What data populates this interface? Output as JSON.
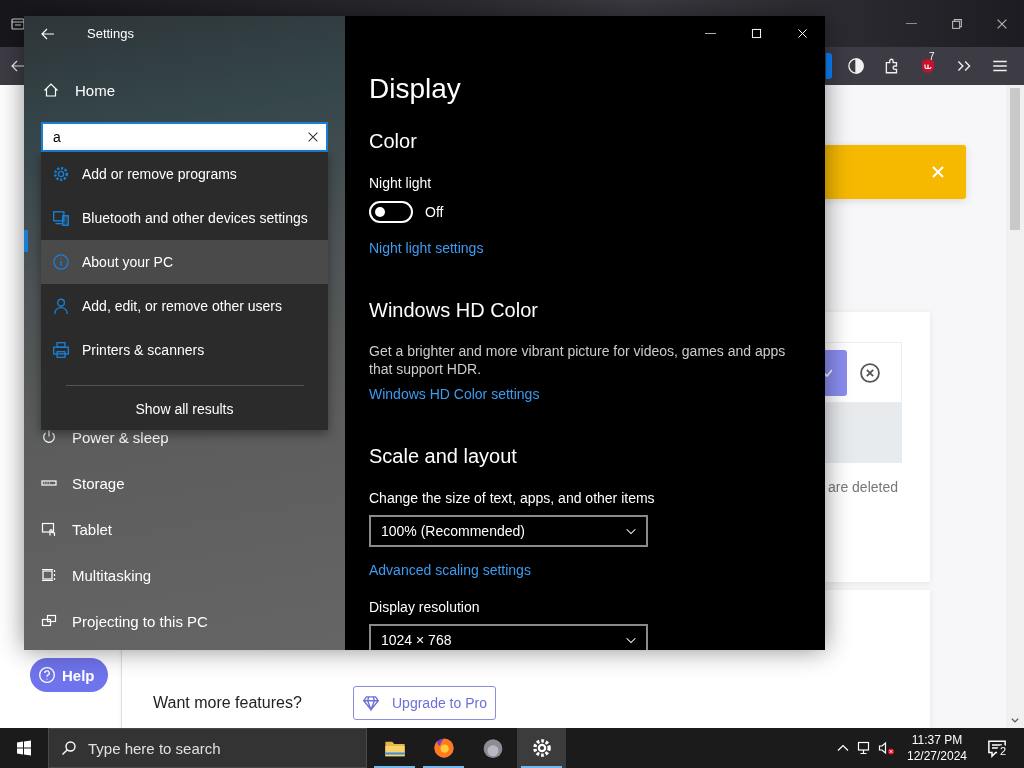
{
  "browser": {
    "extension_badge": "7",
    "card": {
      "note": "are deleted"
    },
    "help_button": "Help",
    "upgrade": {
      "prompt": "Want more features?",
      "button": "Upgrade to Pro"
    }
  },
  "settings": {
    "title": "Settings",
    "home": "Home",
    "search": {
      "value": "a"
    },
    "results": [
      {
        "label": "Add or remove programs",
        "selected": false
      },
      {
        "label": "Bluetooth and other devices settings",
        "selected": false
      },
      {
        "label": "About your PC",
        "selected": true
      },
      {
        "label": "Add, edit, or remove other users",
        "selected": false
      },
      {
        "label": "Printers & scanners",
        "selected": false
      }
    ],
    "show_all": "Show all results",
    "nav": [
      "Power & sleep",
      "Storage",
      "Tablet",
      "Multitasking",
      "Projecting to this PC"
    ],
    "content": [
      {
        "kind": "title",
        "text": "Display"
      },
      {
        "kind": "heading",
        "text": "Color"
      },
      {
        "kind": "label",
        "text": "Night light"
      },
      {
        "kind": "toggle",
        "on": false,
        "text": "Off"
      },
      {
        "kind": "link",
        "text": "Night light settings"
      },
      {
        "kind": "heading",
        "text": "Windows HD Color"
      },
      {
        "kind": "text",
        "text": "Get a brighter and more vibrant picture for videos, games and apps that support HDR."
      },
      {
        "kind": "link",
        "text": "Windows HD Color settings"
      },
      {
        "kind": "heading",
        "text": "Scale and layout"
      },
      {
        "kind": "label",
        "text": "Change the size of text, apps, and other items"
      },
      {
        "kind": "dropdown",
        "value": "100% (Recommended)"
      },
      {
        "kind": "link",
        "text": "Advanced scaling settings"
      },
      {
        "kind": "label",
        "text": "Display resolution"
      },
      {
        "kind": "dropdown",
        "value": "1024 × 768"
      }
    ]
  },
  "taskbar": {
    "search": {
      "placeholder": "Type here to search"
    },
    "apps": [
      {
        "running": true,
        "active": false
      },
      {
        "running": true,
        "active": false
      },
      {
        "running": false,
        "active": false
      },
      {
        "running": true,
        "active": true
      }
    ],
    "time": "11:37 PM",
    "date": "12/27/2024",
    "notifications": "2"
  }
}
